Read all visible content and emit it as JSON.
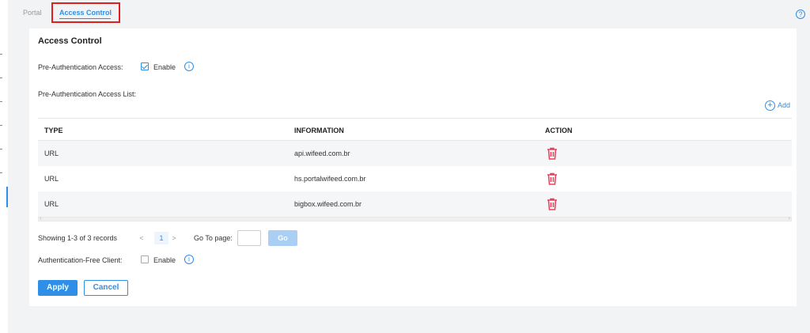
{
  "tabs": {
    "portal": "Portal",
    "access_control": "Access Control"
  },
  "help_glyph": "?",
  "card": {
    "title": "Access Control",
    "pre_auth_label": "Pre-Authentication Access:",
    "pre_auth_checked": true,
    "enable": "Enable",
    "list_label": "Pre-Authentication Access List:",
    "add": "Add",
    "columns": [
      "TYPE",
      "INFORMATION",
      "ACTION"
    ],
    "rows": [
      {
        "type": "URL",
        "info": "api.wifeed.com.br"
      },
      {
        "type": "URL",
        "info": "hs.portalwifeed.com.br"
      },
      {
        "type": "URL",
        "info": "bigbox.wifeed.com.br"
      }
    ],
    "pager": {
      "showing": "Showing 1-3 of 3 records",
      "prev": "<",
      "page": "1",
      "next": ">",
      "goto": "Go To page:",
      "go": "Go"
    },
    "auth_free_label": "Authentication-Free Client:",
    "auth_free_checked": false,
    "apply": "Apply",
    "cancel": "Cancel"
  },
  "colors": {
    "accent": "#2f8ee5",
    "danger": "#e8405a",
    "highlight_border": "#e02020"
  }
}
